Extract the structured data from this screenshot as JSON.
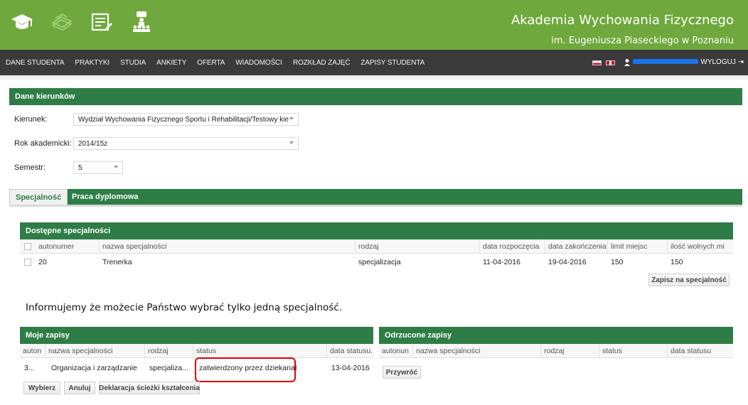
{
  "header": {
    "title": "Akademia Wychowania Fizycznego",
    "subtitle": "im. Eugeniusza Piaseckiego w Poznaniu",
    "icons": [
      "graduation-cap-icon",
      "books-icon",
      "document-icon",
      "group-icon"
    ],
    "color": "#6fa83c"
  },
  "nav": {
    "items": [
      "DANE STUDENTA",
      "PRAKTYKI",
      "STUDIA",
      "ANKIETY",
      "OFERTA",
      "WIADOMOŚCI",
      "ROZKŁAD ZAJĘĆ",
      "ZAPISY STUDENTA"
    ],
    "logout": "WYLOGUJ"
  },
  "kierunki": {
    "title": "Dane kierunków",
    "kierunek_label": "Kierunek:",
    "kierunek_value": "Wydział Wychowania Fizycznego Sportu i Rehabilitacji/Testowy kie",
    "rok_label": "Rok akademicki:",
    "rok_value": "2014/15z",
    "semestr_label": "Semestr:",
    "semestr_value": "5"
  },
  "tabs": [
    "Specjalność",
    "Praca dyplomowa"
  ],
  "dostepne": {
    "title": "Dostępne specjalności",
    "columns": [
      "autonumer",
      "nazwa specjalności",
      "rodzaj",
      "data rozpoczęcia",
      "data zakończenia",
      "limit miejsc",
      "ilość wolnych mi"
    ],
    "rows": [
      [
        "20",
        "Trenerka",
        "specjalizacja",
        "11-04-2016",
        "19-04-2016",
        "150",
        "150"
      ]
    ],
    "button": "Zapisz na specjalność"
  },
  "info": "Informujemy że możecie Państwo wybrać tylko jedną specjalność.",
  "moje": {
    "title": "Moje zapisy",
    "columns": [
      "auton",
      "nazwa specjalności",
      "rodzaj",
      "status",
      "data statusu."
    ],
    "rows": [
      [
        "3...",
        "Organizacja i zarządzanie",
        "specjaliza...",
        "zatwierdzony przez dziekanat",
        "13-04-2016"
      ]
    ],
    "buttons": [
      "Wybierz",
      "Anuluj",
      "Deklaracja ścieżki kształcenia"
    ]
  },
  "odrzucone": {
    "title": "Odrzucone zapisy",
    "columns": [
      "autonun",
      "nazwa specjalności",
      "rodzaj",
      "status",
      "data statusu"
    ],
    "button": "Przywróć"
  },
  "colors": {
    "panel": "#2e7d46",
    "nav": "#3a3a3a",
    "highlight": "#e00000"
  }
}
